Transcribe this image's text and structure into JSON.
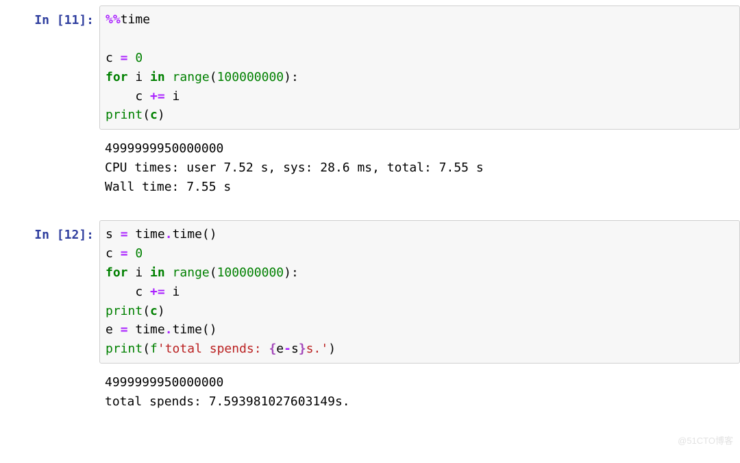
{
  "cell1": {
    "prompt_label": "In [11]:",
    "line1_magic": "%%",
    "line1_cmd": "time",
    "line3_var": "c",
    "line3_op": " = ",
    "line3_val": "0",
    "line4_for": "for",
    "line4_i": " i ",
    "line4_in": "in",
    "line4_range": " range",
    "line4_paren_o": "(",
    "line4_arg": "100000000",
    "line4_paren_c": ")",
    "line4_colon": ":",
    "line5_indent": "    c ",
    "line5_op": "+=",
    "line5_rest": " i",
    "line6_print": "print",
    "line6_po": "(",
    "line6_arg": "c",
    "line6_pc": ")",
    "output_line1": "4999999950000000",
    "output_line2": "CPU times: user 7.52 s, sys: 28.6 ms, total: 7.55 s",
    "output_line3": "Wall time: 7.55 s"
  },
  "cell2": {
    "prompt_label": "In [12]:",
    "l1_s": "s ",
    "l1_op": "=",
    "l1_rest": " time",
    "l1_dot": ".",
    "l1_time": "time",
    "l1_po": "()",
    "l2_c": "c ",
    "l2_op": "=",
    "l2_sp": " ",
    "l2_v": "0",
    "l3_for": "for",
    "l3_i": " i ",
    "l3_in": "in",
    "l3_rng": " range",
    "l3_po": "(",
    "l3_arg": "100000000",
    "l3_pc": ")",
    "l3_col": ":",
    "l4_ind": "    c ",
    "l4_op": "+=",
    "l4_r": " i",
    "l5_pr": "print",
    "l5_po": "(",
    "l5_arg": "c",
    "l5_pc": ")",
    "l6_e": "e ",
    "l6_op": "=",
    "l6_r": " time",
    "l6_dot": ".",
    "l6_t": "time",
    "l6_p": "()",
    "l7_pr": "print",
    "l7_po": "(",
    "l7_fpre": "f",
    "l7_q1": "'",
    "l7_s1": "total spends: ",
    "l7_ob": "{",
    "l7_ex": "e",
    "l7_mn": "-",
    "l7_ex2": "s",
    "l7_cb": "}",
    "l7_s2": "s.",
    "l7_q2": "'",
    "l7_pc": ")",
    "output_line1": "4999999950000000",
    "output_line2": "total spends: 7.593981027603149s."
  },
  "watermark": "@51CTO博客"
}
